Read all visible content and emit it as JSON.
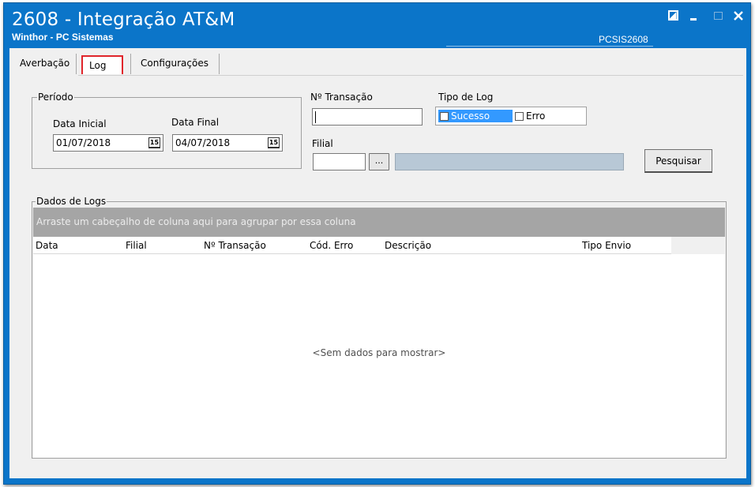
{
  "window": {
    "title": "2608 - Integração AT&M",
    "subtitle": "Winthor - PC Sistemas",
    "code": "PCSIS2608",
    "controls": [
      "restore-icon",
      "minimize-icon",
      "maximize-icon",
      "close-icon"
    ]
  },
  "tabs": [
    {
      "label": "Averbação"
    },
    {
      "label": "Log",
      "active": true
    },
    {
      "label": "Configurações"
    }
  ],
  "periodo": {
    "legend": "Período",
    "data_inicial_label": "Data Inicial",
    "data_inicial_value": "01/07/2018",
    "data_final_label": "Data Final",
    "data_final_value": "04/07/2018",
    "calendar_glyph": "15"
  },
  "transacao": {
    "label": "Nº Transação",
    "value": ""
  },
  "tipo_log": {
    "label": "Tipo de Log",
    "options": [
      {
        "label": "Sucesso",
        "checked": false
      },
      {
        "label": "Erro",
        "checked": false
      }
    ]
  },
  "filial": {
    "label": "Filial",
    "value": "",
    "lookup_button": "...",
    "description": ""
  },
  "search_button": "Pesquisar",
  "dados_logs": {
    "legend": "Dados de Logs",
    "group_hint": "Arraste um cabeçalho de coluna aqui para agrupar por essa coluna",
    "columns": [
      "Data",
      "Filial",
      "Nº Transação",
      "Cód. Erro",
      "Descrição",
      "Tipo Envio"
    ],
    "rows": [],
    "empty_text": "<Sem dados para mostrar>"
  },
  "colors": {
    "titlebar": "#0b75c9",
    "selection": "#3399ff",
    "group_area": "#a5a5a5",
    "tab_highlight": "#e0252b"
  }
}
